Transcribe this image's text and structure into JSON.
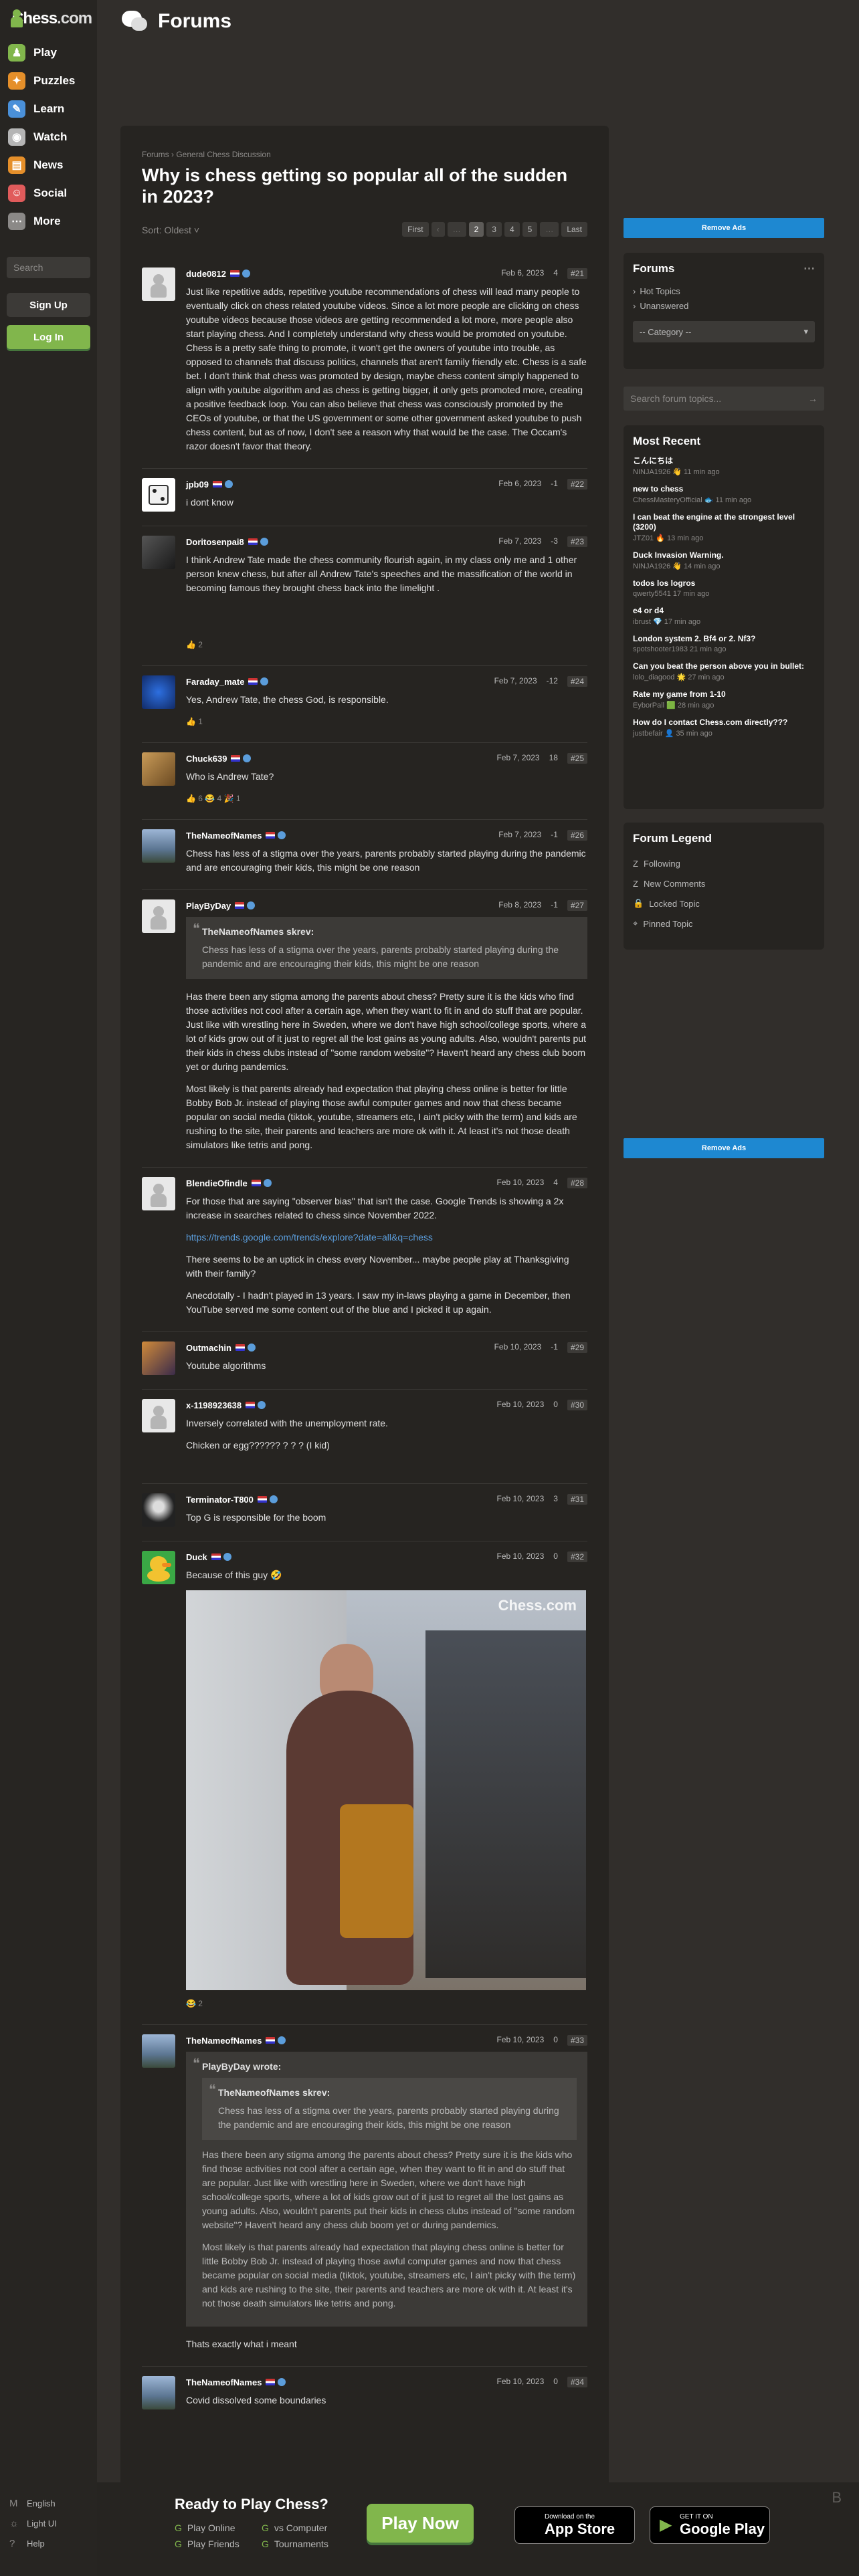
{
  "brand": {
    "name": "Chess",
    "tld": ".com"
  },
  "nav": [
    {
      "label": "Play",
      "icon": "play-icon",
      "color": "#81b64c"
    },
    {
      "label": "Puzzles",
      "icon": "puzzle-icon",
      "color": "#e58f2a"
    },
    {
      "label": "Learn",
      "icon": "learn-icon",
      "color": "#4a90d9"
    },
    {
      "label": "Watch",
      "icon": "watch-icon",
      "color": "#b5b5b5"
    },
    {
      "label": "News",
      "icon": "news-icon",
      "color": "#e58f2a"
    },
    {
      "label": "Social",
      "icon": "social-icon",
      "color": "#e05b5b"
    },
    {
      "label": "More",
      "icon": "more-icon",
      "color": "#8b8987"
    }
  ],
  "sidebar": {
    "search_placeholder": "Search",
    "signup": "Sign Up",
    "login": "Log In",
    "footer": [
      {
        "icon": "M",
        "label": "English"
      },
      {
        "icon": "☼",
        "label": "Light UI"
      },
      {
        "icon": "?",
        "label": "Help"
      }
    ]
  },
  "header": {
    "title": "Forums"
  },
  "topic": {
    "breadcrumb": [
      "Forums",
      "General Chess Discussion"
    ],
    "title": "Why is chess getting so popular all of the sudden in 2023?",
    "sort": "Sort: Oldest",
    "pager": [
      "First",
      "‹",
      "…",
      "2",
      "3",
      "4",
      "5",
      "…",
      "Last"
    ]
  },
  "posts": [
    {
      "user": "dude0812",
      "date": "Feb 6, 2023",
      "votes": "4",
      "num": "#21",
      "avatar": "pawn",
      "paras": [
        "Just like repetitive adds, repetitive youtube recommendations of chess will lead many people to eventually click on chess related youtube videos. Since a lot more people are clicking on chess youtube videos because those videos are getting recommended a lot more, more people also start playing chess. And I completely understand why chess would be promoted on youtube. Chess is a pretty safe thing to promote, it won't get the owners of youtube into trouble, as opposed to channels that discuss politics, channels that aren't family friendly etc. Chess is a safe bet. I don't think that chess was promoted by design, maybe chess content simply happened to align with youtube algorithm and as chess is getting bigger, it only gets promoted more, creating a positive feedback loop. You can also believe that chess was consciously promoted by the CEOs of youtube, or that the US government or some other government asked youtube to push chess content, but as of now, I don't see a reason why that would be the case. The Occam's razor doesn't favor that theory."
      ]
    },
    {
      "user": "jpb09",
      "date": "Feb 6, 2023",
      "votes": "-1",
      "num": "#22",
      "avatar": "dice",
      "paras": [
        "i dont know"
      ]
    },
    {
      "user": "Doritosenpai8",
      "date": "Feb 7, 2023",
      "votes": "-3",
      "num": "#23",
      "avatar": "dark",
      "paras": [
        "I think Andrew Tate made the chess community flourish again, in my class only me and 1 other person knew chess, but after all Andrew Tate's speeches and the massification of the world in becoming famous they brought chess back into the limelight ."
      ],
      "react": "👍 2",
      "spacer": true
    },
    {
      "user": "Faraday_mate",
      "date": "Feb 7, 2023",
      "votes": "-12",
      "num": "#24",
      "avatar": "blue",
      "paras": [
        "Yes, Andrew Tate, the chess God, is responsible."
      ],
      "react": "👍 1"
    },
    {
      "user": "Chuck639",
      "date": "Feb 7, 2023",
      "votes": "18",
      "num": "#25",
      "avatar": "lion",
      "paras": [
        "Who is Andrew Tate?"
      ],
      "react": "👍 6  😂 4  🎉 1"
    },
    {
      "user": "TheNameofNames",
      "date": "Feb 7, 2023",
      "votes": "-1",
      "num": "#26",
      "avatar": "sky",
      "paras": [
        "Chess has less of a stigma over the years, parents probably started playing during the pandemic and are encouraging their kids, this might be one reason"
      ]
    },
    {
      "user": "PlayByDay",
      "date": "Feb 8, 2023",
      "votes": "-1",
      "num": "#27",
      "avatar": "pawn",
      "quote": {
        "head": "TheNameofNames skrev:",
        "text": "Chess has less of a stigma over the years, parents probably started playing during the pandemic and are encouraging their kids, this might be one reason"
      },
      "paras": [
        "Has there been any stigma among the parents about chess? Pretty sure it is the kids who find those activities not cool after a certain age, when they want to fit in and do stuff that are popular. Just like with wrestling here in Sweden, where we don't have high school/college sports, where a lot of kids grow out of it just to regret all the lost gains as young adults. Also, wouldn't parents put their kids in chess clubs instead of \"some random website\"? Haven't heard any chess club boom yet or during pandemics.",
        "Most likely is that parents already had expectation that playing chess online is better for little Bobby Bob Jr. instead of playing those awful computer games and now that chess became popular on social media (tiktok, youtube, streamers etc, I ain't picky with the term) and kids are rushing to the site, their parents and teachers are more ok with it. At least it's not those death simulators like tetris and pong."
      ]
    },
    {
      "user": "BlendieOfindle",
      "date": "Feb 10, 2023",
      "votes": "4",
      "num": "#28",
      "avatar": "pawn",
      "paras": [
        "For those that are saying \"observer bias\" that isn't the case.  Google Trends is showing a 2x increase in searches related to chess since November 2022."
      ],
      "link": "https://trends.google.com/trends/explore?date=all&q=chess",
      "paras2": [
        "There seems to be an uptick in chess every November... maybe people play at Thanksgiving with their family?",
        "Anecdotally - I hadn't played in 13 years.  I saw my in-laws playing a game in December, then YouTube served me some content out of the blue and I picked it up again."
      ]
    },
    {
      "user": "Outmachin",
      "date": "Feb 10, 2023",
      "votes": "-1",
      "num": "#29",
      "avatar": "art",
      "paras": [
        "Youtube algorithms"
      ]
    },
    {
      "user": "x-1198923638",
      "date": "Feb 10, 2023",
      "votes": "0",
      "num": "#30",
      "avatar": "pawn",
      "paras": [
        "Inversely correlated with the unemployment rate.",
        "Chicken or egg?????? ? ? ?  (I kid)"
      ],
      "spacer": true
    },
    {
      "user": "Terminator-T800",
      "date": "Feb 10, 2023",
      "votes": "3",
      "num": "#31",
      "avatar": "skull",
      "paras": [
        "Top G is responsible for the boom"
      ]
    },
    {
      "user": "Duck",
      "date": "Feb 10, 2023",
      "votes": "0",
      "num": "#32",
      "avatar": "duck",
      "paras": [
        "Because of this guy 🤣"
      ],
      "gif": "Chess.com",
      "react": "😂 2"
    },
    {
      "user": "TheNameofNames",
      "date": "Feb 10, 2023",
      "votes": "0",
      "num": "#33",
      "avatar": "sky",
      "nested": {
        "head": "PlayByDay wrote:",
        "inner_head": "TheNameofNames skrev:",
        "inner_text": "Chess has less of a stigma over the years, parents probably started playing during the pandemic and are encouraging their kids, this might be one reason",
        "paras": [
          "Has there been any stigma among the parents about chess? Pretty sure it is the kids who find those activities not cool after a certain age, when they want to fit in and do stuff that are popular. Just like with wrestling here in Sweden, where we don't have high school/college sports, where a lot of kids grow out of it just to regret all the lost gains as young adults. Also, wouldn't parents put their kids in chess clubs instead of \"some random website\"? Haven't heard any chess club boom yet or during pandemics.",
          "Most likely is that parents already had expectation that playing chess online is better for little Bobby Bob Jr. instead of playing those awful computer games and now that chess became popular on social media (tiktok, youtube, streamers etc, I ain't picky with the term) and kids are rushing to the site, their parents and teachers are more ok with it. At least it's not those death simulators like tetris and pong."
        ]
      },
      "paras": [
        "Thats exactly what i meant"
      ]
    },
    {
      "user": "TheNameofNames",
      "date": "Feb 10, 2023",
      "votes": "0",
      "num": "#34",
      "avatar": "sky",
      "paras": [
        "Covid dissolved some boundaries"
      ]
    }
  ],
  "right": {
    "remove_ads": "Remove Ads",
    "forums": {
      "title": "Forums",
      "items": [
        "Hot Topics",
        "Unanswered"
      ],
      "category": "-- Category --"
    },
    "search_placeholder": "Search forum topics...",
    "recent": {
      "title": "Most Recent",
      "items": [
        {
          "t": "こんにちは",
          "u": "NINJA1926 👋 11 min ago"
        },
        {
          "t": "new to chess",
          "u": "ChessMasteryOfficial 🐟 11 min ago"
        },
        {
          "t": "I can beat the engine at the strongest level (3200)",
          "u": "JTZ01 🔥 13 min ago"
        },
        {
          "t": "Duck Invasion Warning.",
          "u": "NINJA1926 👋 14 min ago"
        },
        {
          "t": "todos los logros",
          "u": "qwerty5541 17 min ago"
        },
        {
          "t": "e4 or d4",
          "u": "ibrust 💎 17 min ago"
        },
        {
          "t": "London system 2. Bf4 or 2. Nf3?",
          "u": "spotshooter1983 21 min ago"
        },
        {
          "t": "Can you beat the person above you in bullet:",
          "u": "lolo_diagood 🌟 27 min ago"
        },
        {
          "t": "Rate my game from 1-10",
          "u": "EyborPall 🟩 28 min ago"
        },
        {
          "t": "How do I contact Chess.com directly???",
          "u": "justbefair 👤 35 min ago"
        }
      ]
    },
    "legend": {
      "title": "Forum Legend",
      "items": [
        {
          "icon": "Z",
          "label": "Following"
        },
        {
          "icon": "Z",
          "label": "New Comments"
        },
        {
          "icon": "🔒",
          "label": "Locked Topic"
        },
        {
          "icon": "⌖",
          "label": "Pinned Topic"
        }
      ]
    }
  },
  "footer": {
    "heading": "Ready to Play Chess?",
    "links": [
      "Play Online",
      "vs Computer",
      "Play Friends",
      "Tournaments"
    ],
    "play": "Play Now",
    "app_store": {
      "small": "Download on the",
      "big": "App Store"
    },
    "google": {
      "small": "GET IT ON",
      "big": "Google Play"
    }
  }
}
